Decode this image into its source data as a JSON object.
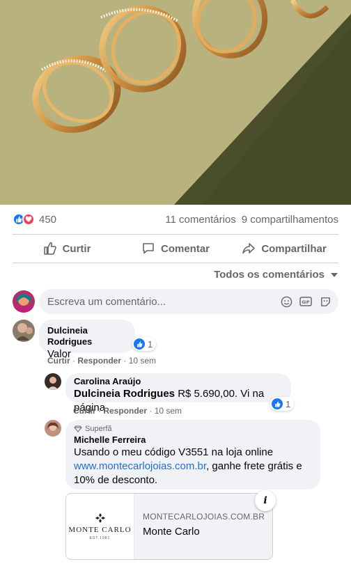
{
  "post": {
    "image_alt": "gold rings on olive background"
  },
  "reactions": {
    "count": "450",
    "comments": "11 comentários",
    "shares": "9 compartilhamentos",
    "icons": [
      "like-icon",
      "love-icon"
    ]
  },
  "actions": {
    "like": "Curtir",
    "comment": "Comentar",
    "share": "Compartilhar"
  },
  "filter": {
    "label": "Todos os comentários"
  },
  "composer": {
    "placeholder": "Escreva um comentário...",
    "icons": [
      "emoji-icon",
      "gif-icon",
      "sticker-icon"
    ]
  },
  "comments": [
    {
      "author": "Dulcineia Rodrigues",
      "text": "Valor",
      "reaction_count": "1",
      "like_action": "Curtir",
      "reply_action": "Responder",
      "time": "10 sem"
    },
    {
      "author": "Carolina Araújo",
      "mention": "Dulcineia Rodrigues",
      "text": " R$ 5.690,00. Vi na página",
      "reaction_count": "1",
      "like_action": "Curtir",
      "reply_action": "Responder",
      "time": "10 sem"
    },
    {
      "badge": "Superfã",
      "author": "Michelle Ferreira",
      "text_line1": "Usando o meu código V3551 na loja online",
      "link": "www.montecarlojoias.com.br",
      "text_line2": ", ganhe frete grátis e",
      "text_line3": "10% de desconto."
    }
  ],
  "link_preview": {
    "logo_text": "MONTE CARLO",
    "logo_sub": "EST.1981",
    "domain": "MONTECARLOJOIAS.COM.BR",
    "title": "Monte Carlo",
    "info_label": "i"
  },
  "colors": {
    "accent": "#1877f2",
    "love": "#f33e58",
    "secondary_text": "#65676b",
    "bubble": "#f0f2f5"
  }
}
